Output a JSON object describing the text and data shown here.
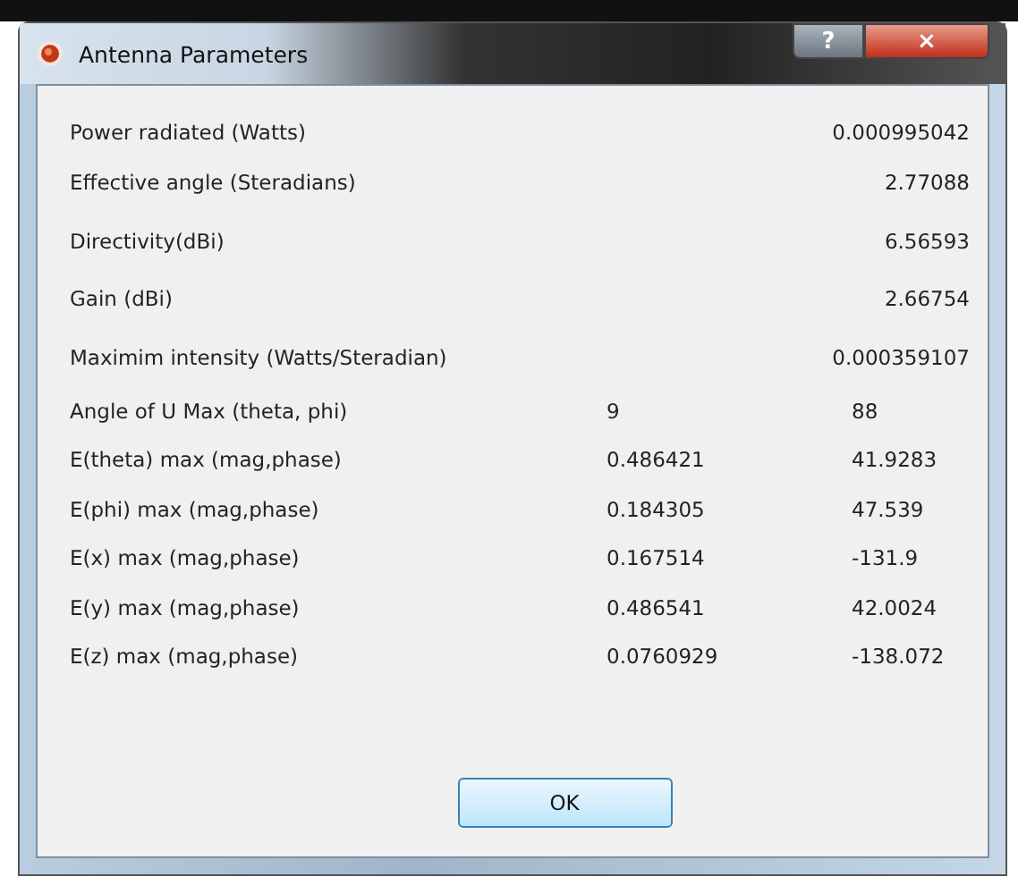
{
  "window": {
    "title": "Antenna Parameters",
    "help": "?",
    "close": "×"
  },
  "rows": [
    {
      "kind": "single",
      "label": "Power radiated (Watts)",
      "values": [
        "0.000995042"
      ]
    },
    {
      "kind": "single",
      "label": "Effective angle (Steradians)",
      "values": [
        "2.77088"
      ]
    },
    {
      "kind": "single",
      "label": "Directivity(dBi)",
      "values": [
        "6.56593"
      ]
    },
    {
      "kind": "single",
      "label": "Gain (dBi)",
      "values": [
        "2.66754"
      ]
    },
    {
      "kind": "single",
      "label": "Maximim intensity (Watts/Steradian)",
      "values": [
        "0.000359107"
      ]
    },
    {
      "kind": "pair",
      "label": "Angle of U Max (theta, phi)",
      "values": [
        "9",
        "88"
      ]
    },
    {
      "kind": "pair",
      "label": "E(theta) max (mag,phase)",
      "values": [
        "0.486421",
        "41.9283"
      ]
    },
    {
      "kind": "pair",
      "label": "E(phi) max (mag,phase)",
      "values": [
        "0.184305",
        "47.539"
      ]
    },
    {
      "kind": "pair",
      "label": "E(x) max (mag,phase)",
      "values": [
        "0.167514",
        "-131.9"
      ]
    },
    {
      "kind": "pair",
      "label": "E(y) max (mag,phase)",
      "values": [
        "0.486541",
        "42.0024"
      ]
    },
    {
      "kind": "pair",
      "label": "E(z) max (mag,phase)",
      "values": [
        "0.0760929",
        "-138.072"
      ]
    }
  ],
  "buttons": [
    "OK"
  ]
}
